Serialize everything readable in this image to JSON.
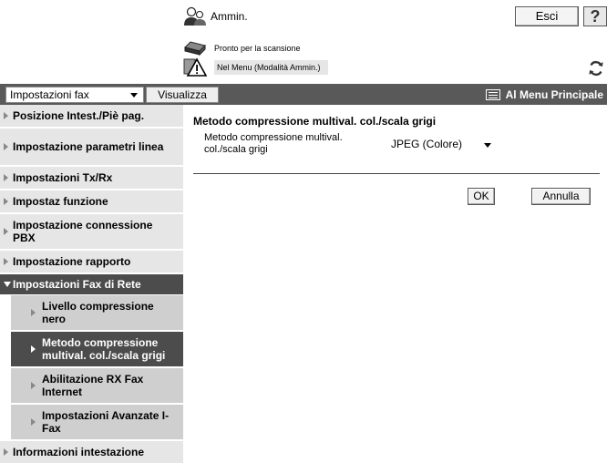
{
  "header": {
    "user_name": "Ammin.",
    "logout_label": "Esci",
    "help_label": "?",
    "status_scan": "Pronto per la scansione",
    "status_mode": "Nel Menu (Modalità Ammin.)"
  },
  "toolbar": {
    "category_select": "Impostazioni fax",
    "view_button": "Visualizza",
    "main_menu_link": "Al Menu Principale"
  },
  "sidebar": {
    "items": [
      {
        "label": "Posizione Intest./Piè pag."
      },
      {
        "label": "Impostazione parametri linea"
      },
      {
        "label": "Impostazioni Tx/Rx"
      },
      {
        "label": "Impostaz funzione"
      },
      {
        "label": "Impostazione connessione PBX"
      },
      {
        "label": "Impostazione rapporto"
      },
      {
        "label": "Impostazioni Fax di Rete"
      },
      {
        "label": "Livello compressione nero"
      },
      {
        "label": "Metodo compressione multival. col./scala grigi"
      },
      {
        "label": "Abilitazione RX Fax Internet"
      },
      {
        "label": "Impostazioni Avanzate I-Fax"
      },
      {
        "label": "Informazioni intestazione"
      }
    ]
  },
  "main": {
    "title": "Metodo compressione multival. col./scala grigi",
    "field_label": "Metodo compressione multival. col./scala grigi",
    "field_value": "JPEG (Colore)",
    "ok_label": "OK",
    "cancel_label": "Annulla"
  },
  "colors": {
    "bar": "#595959",
    "selected": "#4c4c4c",
    "sidebar_bg": "#e6e6e6",
    "submenu_bg": "#cfcfcf"
  }
}
